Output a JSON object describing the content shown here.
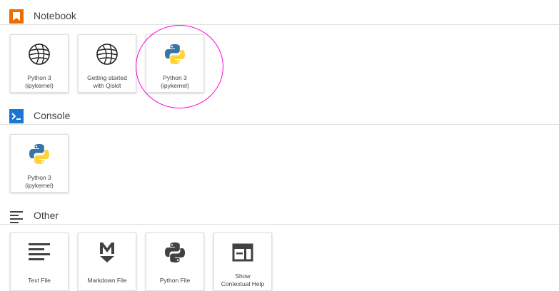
{
  "sections": {
    "notebook": {
      "title": "Notebook",
      "icon": "notebook-bookmark-icon",
      "icon_color": "#ef6c00",
      "items": [
        {
          "label_line1": "Python 3",
          "label_line2": "(ipykernel)",
          "icon": "qiskit-sphere-icon"
        },
        {
          "label_line1": "Getting started",
          "label_line2": "with Qiskit",
          "icon": "qiskit-sphere-icon"
        },
        {
          "label_line1": "Python 3",
          "label_line2": "(ipykernel)",
          "icon": "python-logo-icon"
        }
      ]
    },
    "console": {
      "title": "Console",
      "icon": "console-prompt-icon",
      "icon_color": "#1976d2",
      "items": [
        {
          "label_line1": "Python 3",
          "label_line2": "(ipykernel)",
          "icon": "python-logo-icon"
        }
      ]
    },
    "other": {
      "title": "Other",
      "icon": "text-lines-icon",
      "items": [
        {
          "label_line1": "Text File",
          "icon": "text-file-icon"
        },
        {
          "label_line1": "Markdown File",
          "icon": "markdown-icon"
        },
        {
          "label_line1": "Python File",
          "icon": "python-mono-icon"
        },
        {
          "label_line1": "Show",
          "label_line2": "Contextual Help",
          "icon": "contextual-help-icon"
        }
      ]
    }
  },
  "colors": {
    "highlight": "#ff00d8",
    "python_blue": "#3775a9",
    "python_yellow": "#ffd43b",
    "icon_dark": "#424242"
  }
}
